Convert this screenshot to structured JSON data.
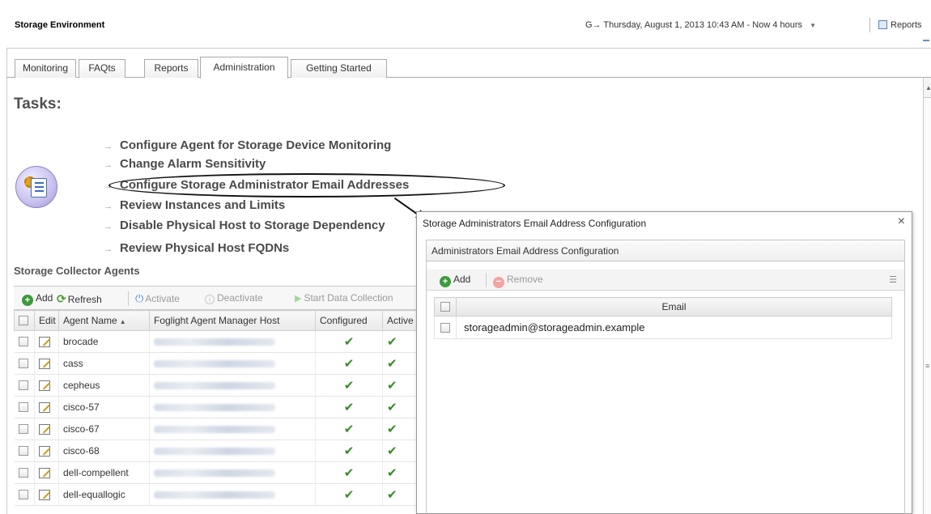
{
  "header": {
    "environment_title": "Storage Environment",
    "time_range": "Thursday, August 1, 2013 10:43 AM - Now 4 hours",
    "time_icon": "G→",
    "reports_label": "Reports"
  },
  "tabs": [
    {
      "label": "Monitoring",
      "active": false
    },
    {
      "label": "FAQts",
      "active": false
    },
    {
      "label": "Reports",
      "active": false
    },
    {
      "label": "Administration",
      "active": true
    },
    {
      "label": "Getting Started",
      "active": false
    }
  ],
  "tasks": {
    "title": "Tasks:",
    "items": [
      "Configure Agent for Storage Device Monitoring",
      "Change Alarm Sensitivity",
      "Configure Storage Administrator Email Addresses",
      "Review Instances and Limits",
      "Disable Physical Host to Storage Dependency",
      "Review Physical Host FQDNs"
    ]
  },
  "agents": {
    "title": "Storage Collector Agents",
    "toolbar": {
      "add": "Add",
      "refresh": "Refresh",
      "activate": "Activate",
      "deactivate": "Deactivate",
      "start": "Start Data Collection"
    },
    "columns": [
      "Edit",
      "Agent Name",
      "Foglight Agent Manager Host",
      "Configured",
      "Active"
    ],
    "rows": [
      {
        "name": "brocade"
      },
      {
        "name": "cass"
      },
      {
        "name": "cepheus"
      },
      {
        "name": "cisco-57"
      },
      {
        "name": "cisco-67"
      },
      {
        "name": "cisco-68"
      },
      {
        "name": "dell-compellent"
      },
      {
        "name": "dell-equallogic"
      }
    ]
  },
  "dialog": {
    "title": "Storage Administrators Email Address Configuration",
    "close": "×",
    "panel_title": "Administrators Email Address Configuration",
    "add": "Add",
    "remove": "Remove",
    "column": "Email",
    "emails": [
      "storageadmin@storageadmin.example"
    ]
  },
  "colors": {
    "accent_green": "#3d9a3d",
    "check_green": "#3a8a2a",
    "disabled_gray": "#9a9a9a"
  }
}
